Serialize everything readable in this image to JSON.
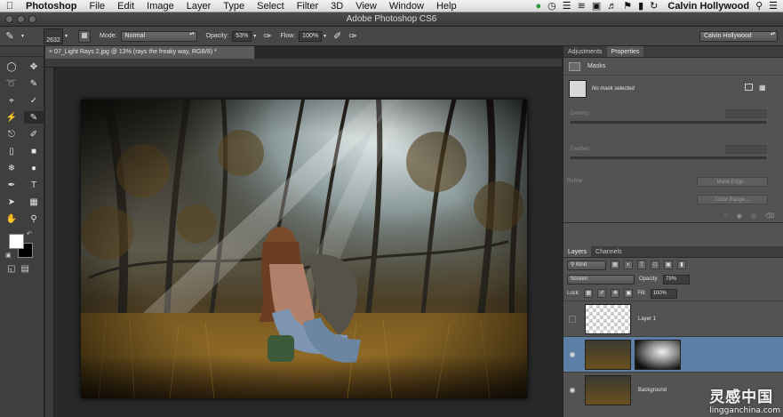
{
  "menubar": {
    "app_name": "Photoshop",
    "items": [
      "File",
      "Edit",
      "Image",
      "Layer",
      "Type",
      "Select",
      "Filter",
      "3D",
      "View",
      "Window",
      "Help"
    ],
    "user": "Calvin Hollywood"
  },
  "window": {
    "title": "Adobe Photoshop CS6"
  },
  "options": {
    "brush_size": "2632",
    "mode_label": "Mode:",
    "mode_value": "Normal",
    "opacity_label": "Opacity:",
    "opacity_value": "53%",
    "flow_label": "Flow:",
    "flow_value": "100%",
    "workspace": "Calvin Hollywood"
  },
  "toolbox": {
    "colors": {
      "foreground": "#ffffff",
      "background": "#000000"
    }
  },
  "document": {
    "tab_label": "07_Light Rays 2.jpg @ 13% (rays the freaky way, RGB/8) *"
  },
  "properties_panel": {
    "tabs": [
      "Adjustments",
      "Properties"
    ],
    "active_tab": "Properties",
    "header": "Masks",
    "no_mask": "No mask selected",
    "density_label": "Density:",
    "feather_label": "Feather:",
    "refine_label": "Refine:",
    "mask_edge_button": "Mask Edge...",
    "color_range_button": "Color Range..."
  },
  "layers_panel": {
    "tabs": [
      "Layers",
      "Channels"
    ],
    "active_tab": "Layers",
    "filter_kind": "Kind",
    "blend_mode": "Screen",
    "opacity_label": "Opacity:",
    "opacity_value": "79%",
    "lock_label": "Lock:",
    "fill_label": "Fill:",
    "fill_value": "100%",
    "layers": [
      {
        "name": "Layer 1",
        "visible": false,
        "selected": false
      },
      {
        "name": "",
        "visible": true,
        "selected": true
      },
      {
        "name": "Background",
        "visible": true,
        "selected": false
      }
    ]
  },
  "watermark": {
    "text": "灵感中国",
    "sub": "lingganchina.com"
  }
}
